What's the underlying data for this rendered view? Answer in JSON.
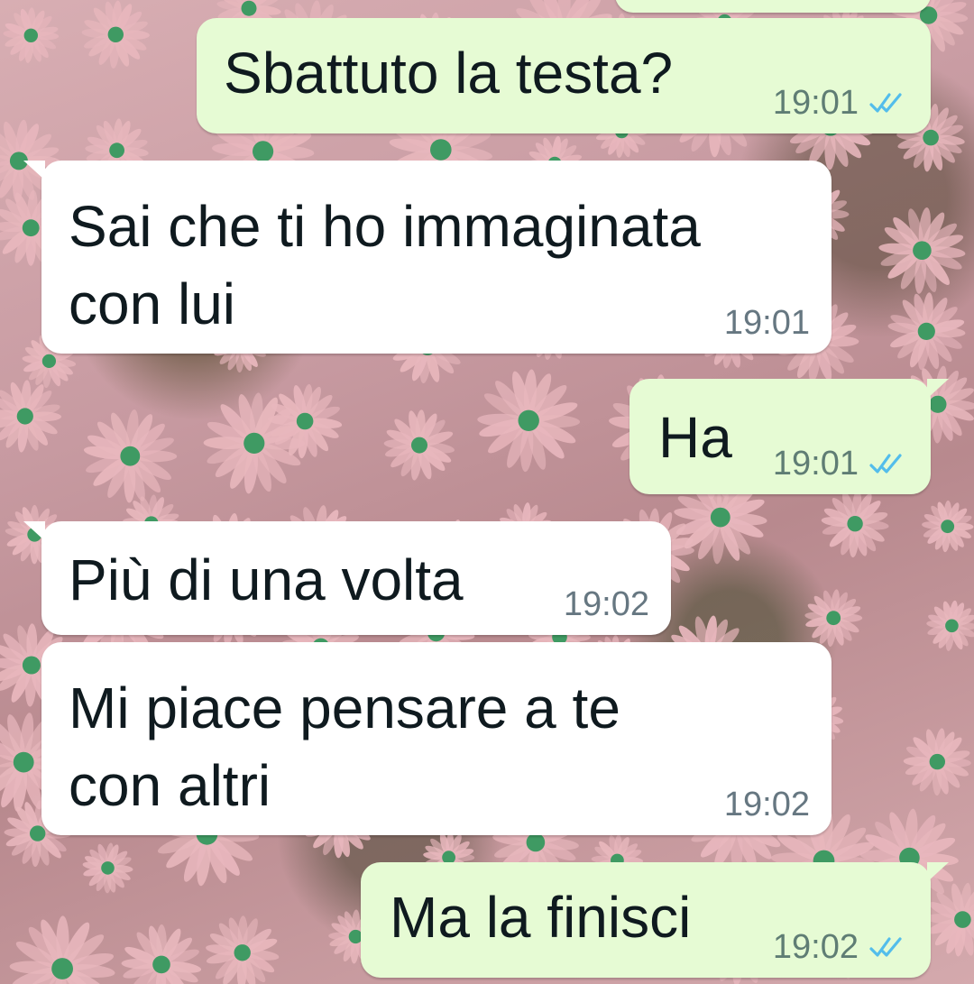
{
  "colors": {
    "incoming_bubble": "#ffffff",
    "outgoing_bubble": "#e6fbd4",
    "message_text": "#0f1a1f",
    "timestamp": "#667781",
    "read_ticks": "#53bdeb",
    "wallpaper_flowers": "#e8b7bd",
    "wallpaper_centers": "#3f9a63"
  },
  "icons": {
    "read_receipt": "double-check-icon"
  },
  "messages": [
    {
      "direction": "out",
      "text": "",
      "time": "",
      "read": false
    },
    {
      "direction": "out",
      "text": "Sbattuto la testa?",
      "time": "19:01",
      "read": true
    },
    {
      "direction": "in",
      "text": "Sai che ti ho immaginata\ncon lui",
      "time": "19:01",
      "read": false
    },
    {
      "direction": "out",
      "text": "Ha",
      "time": "19:01",
      "read": true
    },
    {
      "direction": "in",
      "text": "Più di una volta",
      "time": "19:02",
      "read": false
    },
    {
      "direction": "in",
      "text": "Mi piace pensare a te\ncon altri",
      "time": "19:02",
      "read": false
    },
    {
      "direction": "out",
      "text": "Ma la finisci",
      "time": "19:02",
      "read": true
    }
  ]
}
